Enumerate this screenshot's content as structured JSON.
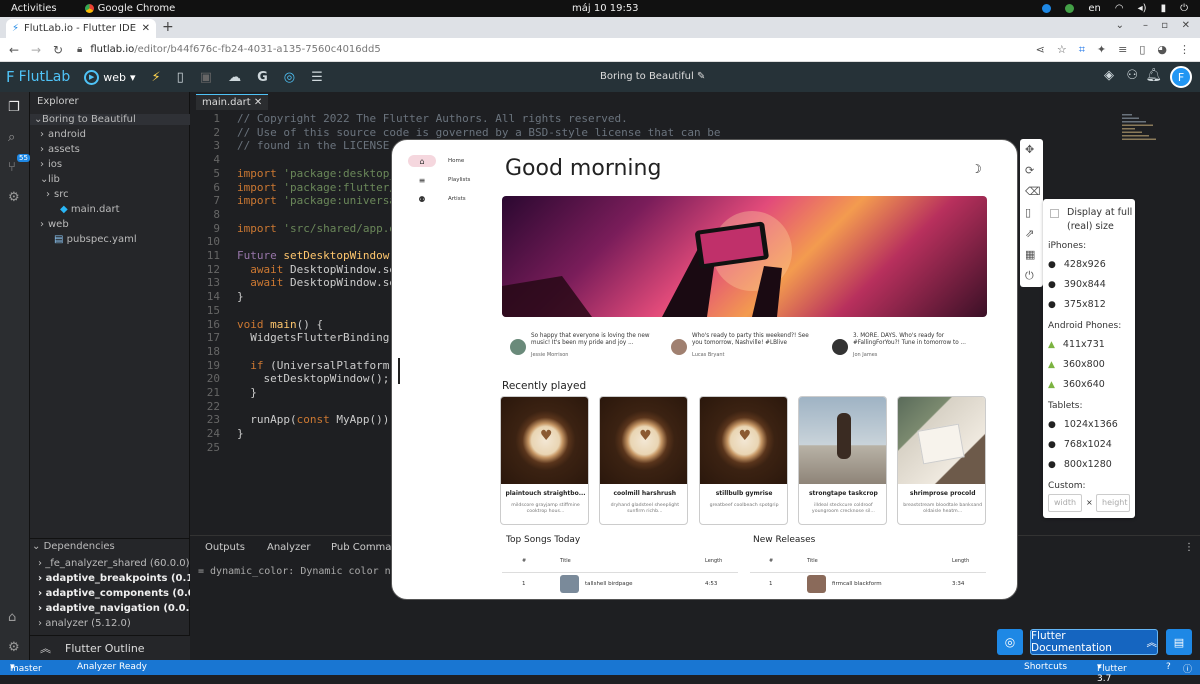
{
  "gnome": {
    "activities": "Activities",
    "app": "Google Chrome",
    "clock": "máj 10  19:53",
    "lang": "en"
  },
  "browser": {
    "tab_title": "FlutLab.io - Flutter IDE on",
    "url_host": "flutlab.io",
    "url_path": "/editor/b44f676c-fb24-4031-a135-7560c4016dd5"
  },
  "toolbar": {
    "logo": "FlutLab",
    "platform": "web",
    "project_title": "Boring to Beautiful",
    "avatar": "F"
  },
  "activity": {
    "badge": "55"
  },
  "explorer": {
    "title": "Explorer",
    "items": [
      {
        "label": "Boring to Beautiful",
        "arrow": "⌄",
        "indent": 4
      },
      {
        "label": "android",
        "arrow": "›",
        "indent": 10
      },
      {
        "label": "assets",
        "arrow": "›",
        "indent": 10
      },
      {
        "label": "ios",
        "arrow": "›",
        "indent": 10
      },
      {
        "label": "lib",
        "arrow": "⌄",
        "indent": 10
      },
      {
        "label": "src",
        "arrow": "›",
        "indent": 16
      },
      {
        "label": "main.dart",
        "arrow": "",
        "indent": 22
      },
      {
        "label": "web",
        "arrow": "›",
        "indent": 10
      },
      {
        "label": "pubspec.yaml",
        "arrow": "",
        "indent": 16
      }
    ]
  },
  "deps": {
    "title": "Dependencies",
    "items": [
      {
        "label": "_fe_analyzer_shared (60.0.0)",
        "bold": false
      },
      {
        "label": "adaptive_breakpoints (0.1.6)",
        "bold": true
      },
      {
        "label": "adaptive_components (0.0.9)",
        "bold": true
      },
      {
        "label": "adaptive_navigation (0.0.9)",
        "bold": true
      },
      {
        "label": "analyzer (5.12.0)",
        "bold": false
      }
    ]
  },
  "outline": "Flutter Outline",
  "editor": {
    "tab": "main.dart",
    "lines": [
      {
        "n": "1",
        "html": "<span class='cm'>// Copyright 2022 The Flutter Authors. All rights reserved.</span>"
      },
      {
        "n": "2",
        "html": "<span class='cm'>// Use of this source code is governed by a BSD-style license that can be</span>"
      },
      {
        "n": "3",
        "html": "<span class='cm'>// found in the LICENSE fi</span>"
      },
      {
        "n": "4",
        "html": ""
      },
      {
        "n": "5",
        "html": "<span class='kw'>import</span> <span class='st'>'package:desktop_wi</span>"
      },
      {
        "n": "6",
        "html": "<span class='kw'>import</span> <span class='st'>'package:flutter/ma</span>"
      },
      {
        "n": "7",
        "html": "<span class='kw'>import</span> <span class='st'>'package:universal_</span>"
      },
      {
        "n": "8",
        "html": ""
      },
      {
        "n": "9",
        "html": "<span class='kw'>import</span> <span class='st'>'src/shared/app.dar</span>"
      },
      {
        "n": "10",
        "html": ""
      },
      {
        "n": "11",
        "html": "<span class='ty'>Future</span> <span class='fn'>setDesktopWindow</span>()"
      },
      {
        "n": "12",
        "html": "  <span class='kw'>await</span> DesktopWindow.setM"
      },
      {
        "n": "13",
        "html": "  <span class='kw'>await</span> DesktopWindow.setW"
      },
      {
        "n": "14",
        "html": "}"
      },
      {
        "n": "15",
        "html": ""
      },
      {
        "n": "16",
        "html": "<span class='kw'>void</span> <span class='fn'>main</span>() {"
      },
      {
        "n": "17",
        "html": "  WidgetsFlutterBinding.en"
      },
      {
        "n": "18",
        "html": ""
      },
      {
        "n": "19",
        "html": "  <span class='kw'>if</span> (UniversalPlatform.is"
      },
      {
        "n": "20",
        "html": "    setDesktopWindow();"
      },
      {
        "n": "21",
        "html": "  }"
      },
      {
        "n": "22",
        "html": ""
      },
      {
        "n": "23",
        "html": "  runApp(<span class='kw'>const</span> MyApp());"
      },
      {
        "n": "24",
        "html": "}"
      },
      {
        "n": "25",
        "html": ""
      }
    ]
  },
  "panel": {
    "tabs": [
      "Outputs",
      "Analyzer",
      "Pub Command"
    ],
    "text": "= dynamic_color: Dynamic color not d"
  },
  "status": {
    "branch": "master",
    "analyzer": "Analyzer Ready",
    "shortcuts": "Shortcuts",
    "flutter": "Flutter 3.7"
  },
  "app": {
    "nav": [
      "Home",
      "Playlists",
      "Artists"
    ],
    "greeting": "Good morning",
    "posts": [
      {
        "text": "So happy that everyone is loving the new music! It's been my pride and joy ...",
        "name": "Jessie Morrison",
        "color": "#6a8a7a"
      },
      {
        "text": "Who's ready to party this weekend?! See you tomorrow, Nashville! #LBlive",
        "name": "Lucas Bryant",
        "color": "#a08070"
      },
      {
        "text": "3. MORE. DAYS. Who's ready for #FallingForYou?! Tune in tomorrow to ...",
        "name": "Jon James",
        "color": "#333"
      }
    ],
    "recent_title": "Recently played",
    "cards": [
      {
        "title": "plaintouch straightbo...",
        "sub": "mildscore grayjamp stiffmine cooktrop hous...",
        "kind": "coffee"
      },
      {
        "title": "coolmill harshrush",
        "sub": "dryhand gladsteel sheeplight sunfirm richb...",
        "kind": "coffee"
      },
      {
        "title": "stillbulb gymrise",
        "sub": "greatbeef coolbeach spotgrip",
        "kind": "coffee"
      },
      {
        "title": "strongtape taskcrop",
        "sub": "illdeal steckcure coldroof youngroom crecknose sil...",
        "kind": "sport"
      },
      {
        "title": "shrimprose procold",
        "sub": "breaststream bloodtale banksand oldaisle heatm...",
        "kind": "book"
      }
    ],
    "top_title": "Top Songs Today",
    "new_title": "New Releases",
    "col_num": "#",
    "col_title": "Title",
    "col_length": "Length",
    "top_row": {
      "n": "1",
      "title": "tallshell birdpage",
      "len": "4:53"
    },
    "new_row": {
      "n": "1",
      "title": "firmcall blackform",
      "len": "3:34"
    }
  },
  "devices": {
    "full_size": "Display at full (real) size",
    "iphones_label": "iPhones:",
    "iphones": [
      "428x926",
      "390x844",
      "375x812"
    ],
    "android_label": "Android Phones:",
    "android": [
      "411x731",
      "360x800",
      "360x640"
    ],
    "tablets_label": "Tablets:",
    "tablets": [
      "1024x1366",
      "768x1024",
      "800x1280"
    ],
    "custom_label": "Custom:",
    "width_ph": "width",
    "height_ph": "height"
  },
  "docs": {
    "label": "Flutter Documentation"
  }
}
